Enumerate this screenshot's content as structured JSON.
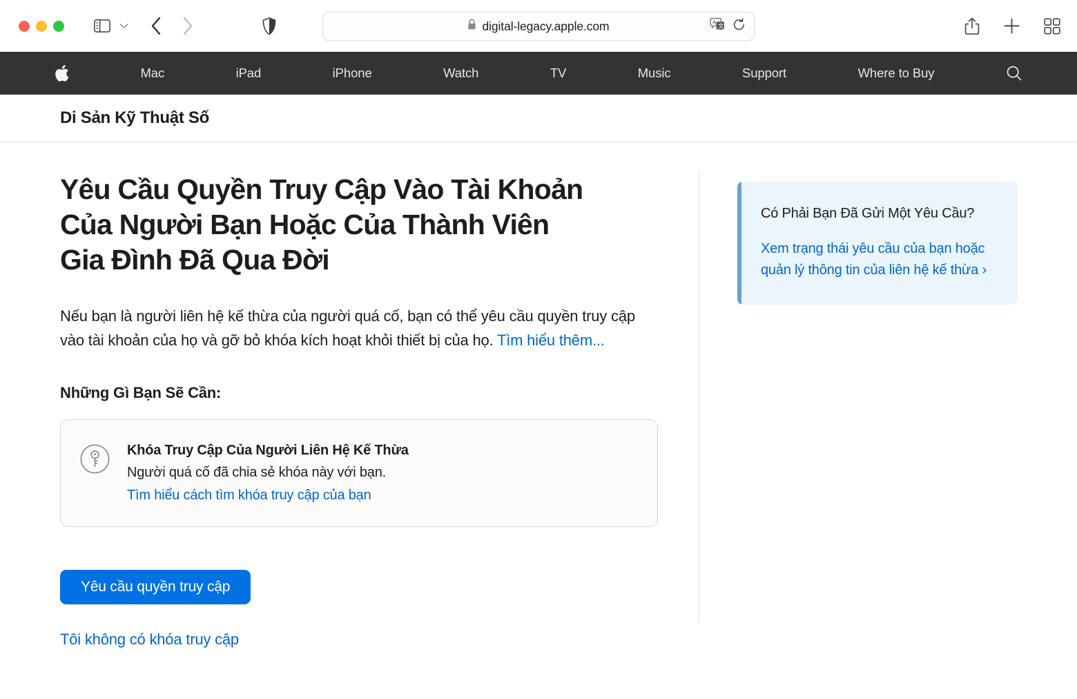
{
  "browser": {
    "window_controls": [
      "close",
      "minimize",
      "zoom"
    ],
    "sidebar_toggle_icon": "sidebar-icon",
    "sidebar_chevron_icon": "chevron-down-icon",
    "back_icon": "chevron-left-icon",
    "forward_icon": "chevron-right-icon",
    "shield_icon": "privacy-shield-icon",
    "url": "digital-legacy.apple.com",
    "lock_icon": "lock-icon",
    "translate_icon": "translate-icon",
    "reload_icon": "reload-icon",
    "share_icon": "share-icon",
    "new_tab_icon": "plus-icon",
    "tab_overview_icon": "tab-overview-icon"
  },
  "globalnav": {
    "logo_icon": "apple-logo-icon",
    "items": [
      {
        "label": "Mac"
      },
      {
        "label": "iPad"
      },
      {
        "label": "iPhone"
      },
      {
        "label": "Watch"
      },
      {
        "label": "TV"
      },
      {
        "label": "Music"
      },
      {
        "label": "Support"
      },
      {
        "label": "Where to Buy"
      }
    ],
    "search_icon": "search-icon"
  },
  "localnav": {
    "title": "Di Sản Kỹ Thuật Số"
  },
  "main": {
    "headline": "Yêu Cầu Quyền Truy Cập Vào Tài Khoản Của Người Bạn Hoặc Của Thành Viên Gia Đình Đã Qua Đời",
    "intro_text": "Nếu bạn là người liên hệ kế thừa của người quá cố, bạn có thể yêu cầu quyền truy cập vào tài khoản của họ và gỡ bỏ khóa kích hoạt khỏi thiết bị của họ. ",
    "intro_link": "Tìm hiểu thêm...",
    "needs_title": "Những Gì Bạn Sẽ Cần:",
    "requirement": {
      "icon": "key-circle-icon",
      "title": "Khóa Truy Cập Của Người Liên Hệ Kế Thừa",
      "description": "Người quá cố đã chia sẻ khóa này với bạn.",
      "link": "Tìm hiểu cách tìm khóa truy cập của bạn"
    },
    "primary_button": "Yêu cầu quyền truy cập",
    "secondary_link": "Tôi không có khóa truy cập"
  },
  "aside": {
    "title": "Có Phải Bạn Đã Gửi Một Yêu Cầu?",
    "link": "Xem trạng thái yêu cầu của bạn hoặc quản lý thông tin của liên hệ kế thừa ›"
  },
  "colors": {
    "accent_blue": "#0071e3",
    "link_blue": "#0066cc",
    "nav_bg": "#333336",
    "aside_bg": "#eaf5fd",
    "aside_bar": "#6f9fd0",
    "card_bg": "#fbfbfb",
    "card_border": "#d9d9d9"
  }
}
